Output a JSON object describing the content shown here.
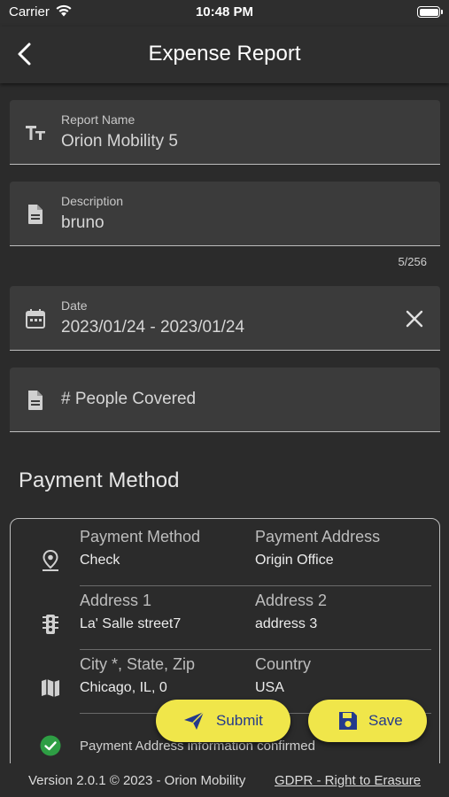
{
  "status_bar": {
    "carrier": "Carrier",
    "time": "10:48 PM"
  },
  "header": {
    "title": "Expense Report",
    "back_icon": "chevron-left-icon"
  },
  "form": {
    "report_name": {
      "label": "Report Name",
      "value": "Orion Mobility 5",
      "icon": "text-size-icon"
    },
    "description": {
      "label": "Description",
      "value": "bruno",
      "counter": "5/256",
      "icon": "document-icon"
    },
    "date": {
      "label": "Date",
      "value": "2023/01/24 - 2023/01/24",
      "icon": "calendar-icon",
      "clear_icon": "close-icon"
    },
    "people_covered": {
      "placeholder": "# People Covered",
      "icon": "document-icon"
    }
  },
  "payment": {
    "section_title": "Payment Method",
    "rows": [
      {
        "icon": "location-pin-icon",
        "label1": "Payment Method",
        "value1": "Check",
        "label2": "Payment Address",
        "value2": "Origin Office"
      },
      {
        "icon": "traffic-light-icon",
        "label1": "Address 1",
        "value1": "La' Salle street7",
        "label2": "Address 2",
        "value2": "address 3"
      },
      {
        "icon": "map-icon",
        "label1": "City *, State, Zip",
        "value1": "Chicago, IL, 0",
        "label2": "Country",
        "value2": "USA"
      }
    ],
    "confirmation": "Payment Address information confirmed",
    "confirmation_icon": "check-circle-icon"
  },
  "actions": {
    "submit_label": "Submit",
    "save_label": "Save"
  },
  "footer": {
    "version": "Version 2.0.1  © 2023 - Orion Mobility",
    "gdpr_link": "GDPR - Right to Erasure"
  },
  "colors": {
    "background": "#2b2b2b",
    "field": "#3b3b3b",
    "fab": "#f0e64a",
    "fab_text": "#243a8c",
    "confirm_green": "#2e9e44"
  }
}
